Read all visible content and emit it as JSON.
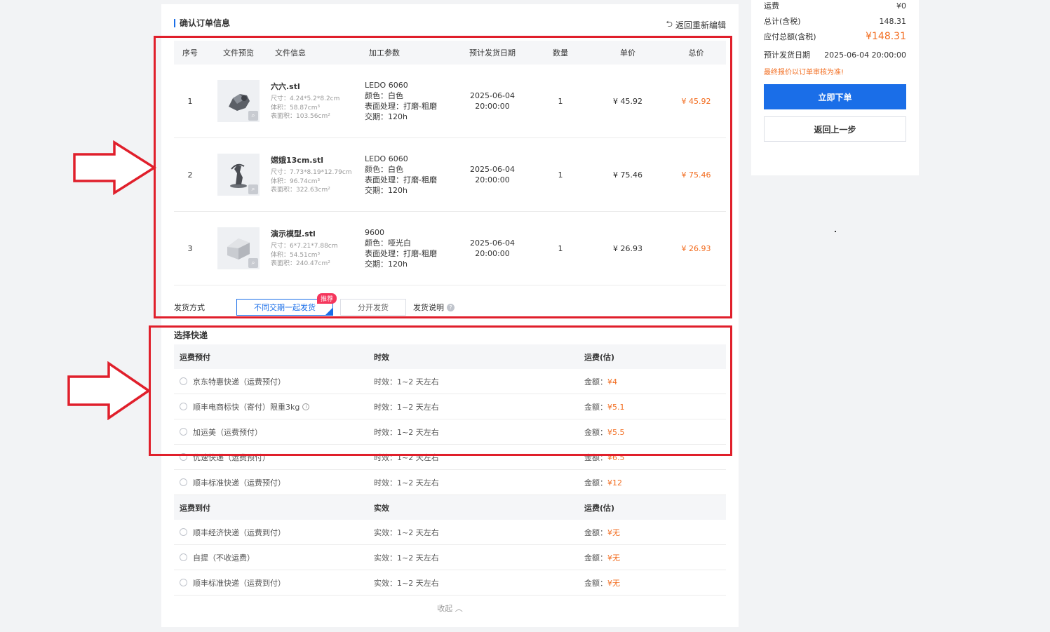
{
  "order": {
    "title": "确认订单信息",
    "reedit_label": "返回重新编辑",
    "columns": [
      "序号",
      "文件预览",
      "文件信息",
      "加工参数",
      "预计发货日期",
      "数量",
      "单价",
      "总价"
    ],
    "rows": [
      {
        "seq": "1",
        "file_name": "六六.stl",
        "size": "尺寸：4.24*5.2*8.2cm",
        "volume": "体积：58.87cm³",
        "area": "表面积：103.56cm²",
        "material": "LEDO 6060",
        "color": "颜色：白色",
        "surface": "表面处理：打磨-粗磨",
        "lead": "交期：120h",
        "date": "2025-06-04",
        "time": "20:00:00",
        "qty": "1",
        "unit_price": "¥ 45.92",
        "total_price": "¥ 45.92"
      },
      {
        "seq": "2",
        "file_name": "嫦娥13cm.stl",
        "size": "尺寸：7.73*8.19*12.79cm",
        "volume": "体积：96.74cm³",
        "area": "表面积：322.63cm²",
        "material": "LEDO 6060",
        "color": "颜色：白色",
        "surface": "表面处理：打磨-粗磨",
        "lead": "交期：120h",
        "date": "2025-06-04",
        "time": "20:00:00",
        "qty": "1",
        "unit_price": "¥ 75.46",
        "total_price": "¥ 75.46"
      },
      {
        "seq": "3",
        "file_name": "演示模型.stl",
        "size": "尺寸：6*7.21*7.88cm",
        "volume": "体积：54.51cm³",
        "area": "表面积：240.47cm²",
        "material": "9600",
        "color": "颜色：哑光白",
        "surface": "表面处理：打磨-粗磨",
        "lead": "交期：120h",
        "date": "2025-06-04",
        "time": "20:00:00",
        "qty": "1",
        "unit_price": "¥ 26.93",
        "total_price": "¥ 26.93"
      }
    ]
  },
  "shipping_method": {
    "label": "发货方式",
    "option_together": "不同交期一起发货",
    "badge": "推荐",
    "option_separate": "分开发货",
    "note": "发货说明"
  },
  "express": {
    "title": "选择快递",
    "prepaid_header": [
      "运费预付",
      "时效",
      "运费(估)"
    ],
    "prepaid": [
      {
        "name": "京东特惠快递（运费预付）",
        "eta": "时效：1~2 天左右",
        "fee_label": "金额：",
        "fee": "¥4"
      },
      {
        "name": "顺丰电商标快（寄付）限重3kg",
        "eta": "时效：1~2 天左右",
        "fee_label": "金额：",
        "fee": "¥5.1",
        "info": true
      },
      {
        "name": "加运美（运费预付）",
        "eta": "时效：1~2 天左右",
        "fee_label": "金额：",
        "fee": "¥5.5"
      },
      {
        "name": "优速快递（运费预付）",
        "eta": "时效：1~2 天左右",
        "fee_label": "金额：",
        "fee": "¥6.5"
      },
      {
        "name": "顺丰标准快递（运费预付）",
        "eta": "时效：1~2 天左右",
        "fee_label": "金额：",
        "fee": "¥12"
      }
    ],
    "collect_header": [
      "运费到付",
      "实效",
      "运费(估)"
    ],
    "collect": [
      {
        "name": "顺丰经济快递（运费到付）",
        "eta": "实效：1~2 天左右",
        "fee_label": "金额：",
        "fee": "¥无"
      },
      {
        "name": "自提（不收运费）",
        "eta": "实效：1~2 天左右",
        "fee_label": "金额：",
        "fee": "¥无"
      },
      {
        "name": "顺丰标准快递（运费到付）",
        "eta": "实效：1~2 天左右",
        "fee_label": "金额：",
        "fee": "¥无"
      }
    ],
    "collapse_label": "收起"
  },
  "summary": {
    "freight_label": "运费",
    "freight_value": "¥0",
    "subtotal_label": "总计(含税)",
    "subtotal_value": "148.31",
    "payable_label": "应付总额(含税)",
    "payable_value": "¥148.31",
    "ship_date_label": "预计发货日期",
    "ship_date_value": "2025-06-04 20:00:00",
    "warning": "最终报价以订单审核为准!",
    "submit_label": "立即下单",
    "back_label": "返回上一步"
  },
  "colors": {
    "accent": "#1a6ee8",
    "price": "#f26b1d",
    "annotation": "#e01f2b",
    "badge": "#f5365c"
  }
}
